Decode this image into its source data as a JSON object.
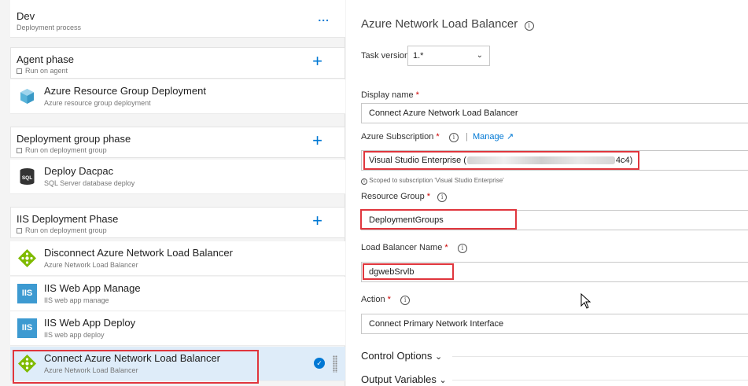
{
  "stage": {
    "name": "Dev",
    "subtitle": "Deployment process",
    "more": "..."
  },
  "phases": [
    {
      "title": "Agent phase",
      "subtitle": "Run on agent"
    },
    {
      "title": "Deployment group phase",
      "subtitle": "Run on deployment group"
    },
    {
      "title": "IIS Deployment Phase",
      "subtitle": "Run on deployment group"
    }
  ],
  "tasks": [
    {
      "title": "Azure Resource Group Deployment",
      "subtitle": "Azure resource group deployment",
      "icon": "azure-cube-icon"
    },
    {
      "title": "Deploy Dacpac",
      "subtitle": "SQL Server database deploy",
      "icon": "sql-database-icon",
      "icon_text": "SQL"
    },
    {
      "title": "Disconnect Azure Network Load Balancer",
      "subtitle": "Azure Network Load Balancer",
      "icon": "load-balancer-icon"
    },
    {
      "title": "IIS Web App Manage",
      "subtitle": "IIS web app manage",
      "icon": "iis-icon",
      "icon_text": "IIS"
    },
    {
      "title": "IIS Web App Deploy",
      "subtitle": "IIS web app deploy",
      "icon": "iis-icon",
      "icon_text": "IIS"
    },
    {
      "title": "Connect Azure Network Load Balancer",
      "subtitle": "Azure Network Load Balancer",
      "icon": "load-balancer-icon",
      "selected": true
    }
  ],
  "panel": {
    "title": "Azure Network Load Balancer",
    "task_version_label": "Task version",
    "task_version_value": "1.*",
    "display_name_label": "Display name",
    "display_name_value": "Connect Azure Network Load Balancer",
    "subscription_label": "Azure Subscription",
    "manage_link": "Manage",
    "subscription_value_prefix": "Visual Studio Enterprise (",
    "subscription_value_suffix": "4c4)",
    "scope_note": "Scoped to subscription 'Visual Studio Enterprise'",
    "resource_group_label": "Resource Group",
    "resource_group_value": "DeploymentGroups",
    "lb_name_label": "Load Balancer Name",
    "lb_name_value": "dgwebSrvlb",
    "action_label": "Action",
    "action_value": "Connect Primary Network Interface",
    "control_options": "Control Options",
    "output_variables": "Output Variables"
  },
  "colors": {
    "accent": "#0078d4",
    "highlight": "#e0363d",
    "selected_bg": "#deecf9"
  }
}
